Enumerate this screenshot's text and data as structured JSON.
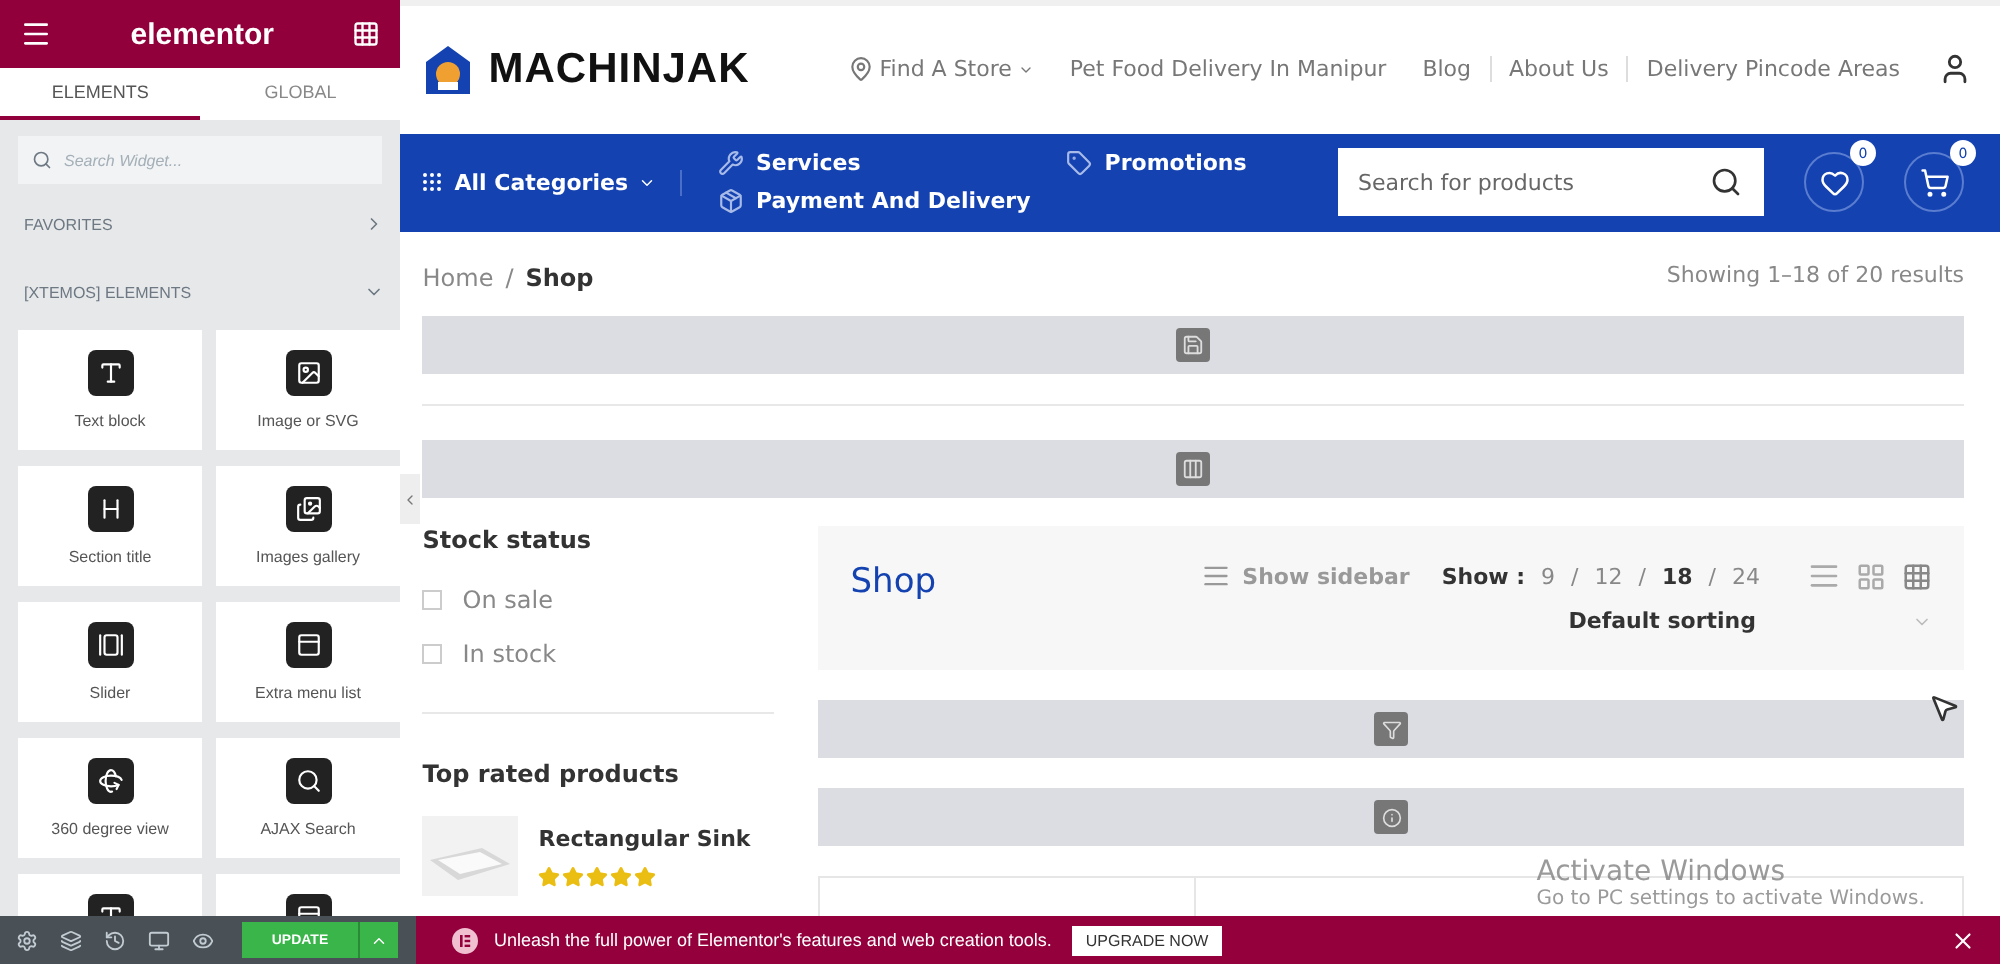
{
  "panel": {
    "brand": "elementor",
    "tabs": [
      {
        "label": "ELEMENTS",
        "selected": true
      },
      {
        "label": "GLOBAL",
        "selected": false
      }
    ],
    "search": {
      "placeholder": "Search Widget..."
    },
    "sections": [
      {
        "label": "FAVORITES",
        "expanded": false
      },
      {
        "label": "[XTEMOS] ELEMENTS",
        "expanded": true
      }
    ],
    "widgets": [
      {
        "label": "Text block",
        "kind": "text"
      },
      {
        "label": "Image or SVG"
      },
      {
        "label": "Section title",
        "kind": "title"
      },
      {
        "label": "Images gallery",
        "kind": "gallery"
      },
      {
        "label": "Slider",
        "kind": "slider"
      },
      {
        "label": "Extra menu list",
        "kind": "menu"
      },
      {
        "label": "360 degree view",
        "kind": "rotate"
      },
      {
        "label": "AJAX Search",
        "kind": "search"
      },
      {
        "kind": "text"
      },
      {
        "kind": "menu"
      }
    ],
    "footer": {
      "update": "UPDATE"
    }
  },
  "header": {
    "logo": "MACHINJAK",
    "nav": [
      {
        "label": "Find A Store",
        "kind": "store"
      },
      {
        "label": "Pet Food Delivery In Manipur",
        "kind": "link"
      },
      {
        "label": "Blog",
        "kind": "link"
      },
      {
        "label": "About Us",
        "kind": "link"
      },
      {
        "label": "Delivery Pincode Areas",
        "kind": "link"
      }
    ],
    "categories": "All Categories",
    "menu": [
      {
        "label": "Services",
        "kind": "services"
      },
      {
        "label": "Promotions",
        "kind": "promotions"
      },
      {
        "label": "Payment And Delivery",
        "kind": "delivery"
      }
    ],
    "search": {
      "placeholder": "Search for products"
    },
    "wishlist_count": "0",
    "cart_count": "0"
  },
  "breadcrumb": [
    {
      "label": "Home",
      "kind": "link"
    },
    {
      "label": "/",
      "kind": "separator"
    },
    {
      "label": "Shop",
      "kind": "current"
    }
  ],
  "results": "Showing 1–18 of 20 results",
  "sidebar": {
    "stock_title": "Stock status",
    "filters": [
      {
        "label": "On sale",
        "checked": false
      },
      {
        "label": "In stock",
        "checked": false
      }
    ],
    "top_title": "Top rated products",
    "products": [
      {
        "name": "Rectangular Sink",
        "stars": 5
      }
    ]
  },
  "shop": {
    "title": "Shop",
    "show_sidebar": "Show sidebar",
    "show_label": "Show :",
    "per_page": [
      {
        "label": "9",
        "kind": "option",
        "selected": false
      },
      {
        "label": "/",
        "kind": "separator"
      },
      {
        "label": "12",
        "kind": "option",
        "selected": false
      },
      {
        "label": "/",
        "kind": "separator"
      },
      {
        "label": "18",
        "kind": "option",
        "selected": true
      },
      {
        "label": "/",
        "kind": "separator"
      },
      {
        "label": "24",
        "kind": "option",
        "selected": false
      }
    ],
    "sorting": "Default sorting"
  },
  "banner": {
    "text": "Unleash the full power of Elementor's features and web creation tools.",
    "button": "UPGRADE NOW"
  },
  "os_notice": {
    "title": "Activate Windows",
    "text": "Go to PC settings to activate Windows."
  }
}
